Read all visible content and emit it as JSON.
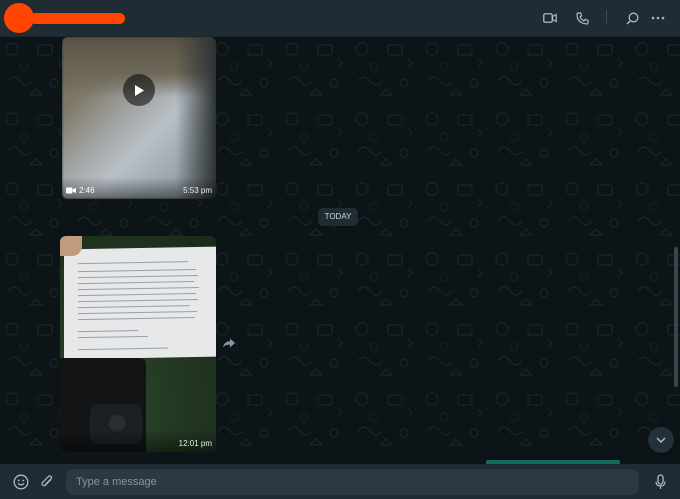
{
  "header": {
    "contact_name": "",
    "icons": [
      "video-call-icon",
      "voice-call-icon",
      "search-icon",
      "menu-icon"
    ]
  },
  "messages": [
    {
      "type": "video",
      "duration": "2:46",
      "time": "5:53 pm"
    },
    {
      "type": "date-divider",
      "label": "TODAY"
    },
    {
      "type": "image",
      "time": "12:01 pm"
    }
  ],
  "composer": {
    "placeholder": "Type a message",
    "value": ""
  },
  "colors": {
    "header_bg": "#202c33",
    "chat_bg": "#0d1418",
    "bubble_bg": "#1f2c33",
    "accent": "#12695c",
    "avatar_redaction": "#ff4500"
  }
}
